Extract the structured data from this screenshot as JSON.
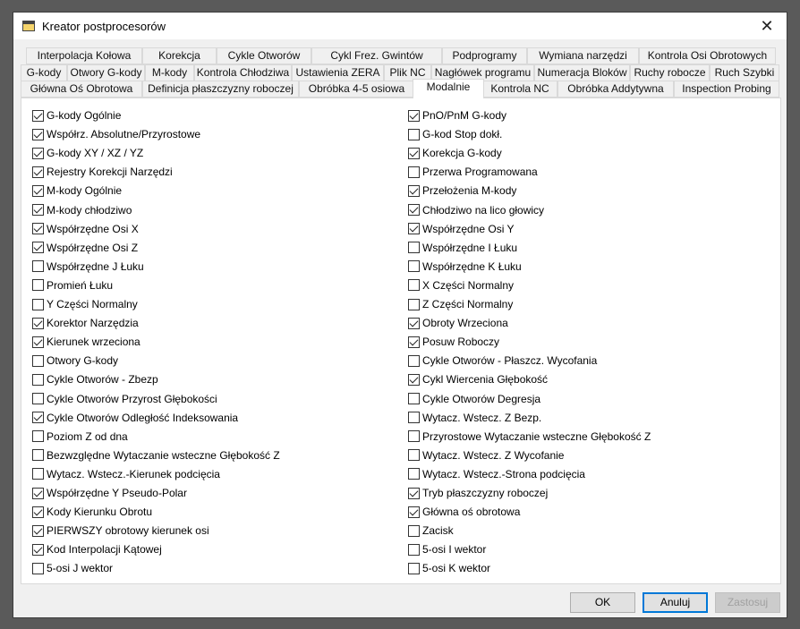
{
  "window": {
    "title": "Kreator postprocesorów",
    "close": "✕"
  },
  "tabs": {
    "row1": [
      "Interpolacja Kołowa",
      "Korekcja",
      "Cykle Otworów",
      "Cykl Frez. Gwintów",
      "Podprogramy",
      "Wymiana narzędzi",
      "Kontrola Osi Obrotowych"
    ],
    "row2": [
      "G-kody",
      "Otwory G-kody",
      "M-kody",
      "Kontrola Chłodziwa",
      "Ustawienia ZERA",
      "Plik NC",
      "Nagłówek programu",
      "Numeracja Bloków",
      "Ruchy robocze",
      "Ruch Szybki"
    ],
    "row3": [
      "Główna Oś Obrotowa",
      "Definicja płaszczyzny roboczej",
      "Obróbka 4-5 osiowa",
      "Modalnie",
      "Kontrola NC",
      "Obróbka Addytywna",
      "Inspection Probing"
    ],
    "selected": "Modalnie"
  },
  "left": [
    {
      "label": "G-kody Ogólnie",
      "checked": true
    },
    {
      "label": "Współrz. Absolutne/Przyrostowe",
      "checked": true
    },
    {
      "label": "G-kody XY / XZ / YZ",
      "checked": true
    },
    {
      "label": "Rejestry Korekcji Narzędzi",
      "checked": true
    },
    {
      "label": "M-kody Ogólnie",
      "checked": true
    },
    {
      "label": "M-kody chłodziwo",
      "checked": true
    },
    {
      "label": "Współrzędne Osi X",
      "checked": true
    },
    {
      "label": "Współrzędne Osi Z",
      "checked": true
    },
    {
      "label": "Współrzędne J Łuku",
      "checked": false
    },
    {
      "label": "Promień Łuku",
      "checked": false
    },
    {
      "label": "Y Części Normalny",
      "checked": false
    },
    {
      "label": "Korektor Narzędzia",
      "checked": true
    },
    {
      "label": "Kierunek wrzeciona",
      "checked": true
    },
    {
      "label": "Otwory G-kody",
      "checked": false
    },
    {
      "label": "Cykle Otworów - Zbezp",
      "checked": false
    },
    {
      "label": "Cykle Otworów Przyrost Głębokości",
      "checked": false
    },
    {
      "label": "Cykle Otworów Odległość Indeksowania",
      "checked": true
    },
    {
      "label": "Poziom Z od dna",
      "checked": false
    },
    {
      "label": "Bezwzględne Wytaczanie wsteczne Głębokość Z",
      "checked": false
    },
    {
      "label": "Wytacz. Wstecz.-Kierunek podcięcia",
      "checked": false
    },
    {
      "label": "Współrzędne Y Pseudo-Polar",
      "checked": true
    },
    {
      "label": "Kody Kierunku Obrotu",
      "checked": true
    },
    {
      "label": "PIERWSZY obrotowy kierunek osi",
      "checked": true
    },
    {
      "label": "Kod Interpolacji Kątowej",
      "checked": true
    },
    {
      "label": "5-osi J wektor",
      "checked": false
    }
  ],
  "right": [
    {
      "label": "PnO/PnM G-kody",
      "checked": true
    },
    {
      "label": "G-kod Stop dokł.",
      "checked": false
    },
    {
      "label": "Korekcja G-kody",
      "checked": true
    },
    {
      "label": "Przerwa Programowana",
      "checked": false
    },
    {
      "label": "Przełożenia M-kody",
      "checked": true
    },
    {
      "label": "Chłodziwo na lico głowicy",
      "checked": true
    },
    {
      "label": "Współrzędne Osi Y",
      "checked": true
    },
    {
      "label": "Współrzędne I Łuku",
      "checked": false
    },
    {
      "label": "Współrzędne K Łuku",
      "checked": false
    },
    {
      "label": "X Części Normalny",
      "checked": false
    },
    {
      "label": "Z Części Normalny",
      "checked": false
    },
    {
      "label": "Obroty Wrzeciona",
      "checked": true
    },
    {
      "label": "Posuw Roboczy",
      "checked": true
    },
    {
      "label": "Cykle Otworów - Płaszcz. Wycofania",
      "checked": false
    },
    {
      "label": "Cykl Wiercenia Głębokość",
      "checked": true
    },
    {
      "label": "Cykle Otworów Degresja",
      "checked": false
    },
    {
      "label": "Wytacz. Wstecz. Z Bezp.",
      "checked": false
    },
    {
      "label": "Przyrostowe Wytaczanie wsteczne Głębokość Z",
      "checked": false
    },
    {
      "label": "Wytacz. Wstecz. Z  Wycofanie",
      "checked": false
    },
    {
      "label": "Wytacz. Wstecz.-Strona podcięcia",
      "checked": false
    },
    {
      "label": "Tryb płaszczyzny roboczej",
      "checked": true
    },
    {
      "label": "Główna oś obrotowa",
      "checked": true
    },
    {
      "label": "Zacisk",
      "checked": false
    },
    {
      "label": "5-osi I wektor",
      "checked": false
    },
    {
      "label": "5-osi K wektor",
      "checked": false
    }
  ],
  "buttons": {
    "ok": "OK",
    "cancel": "Anuluj",
    "apply": "Zastosuj"
  }
}
